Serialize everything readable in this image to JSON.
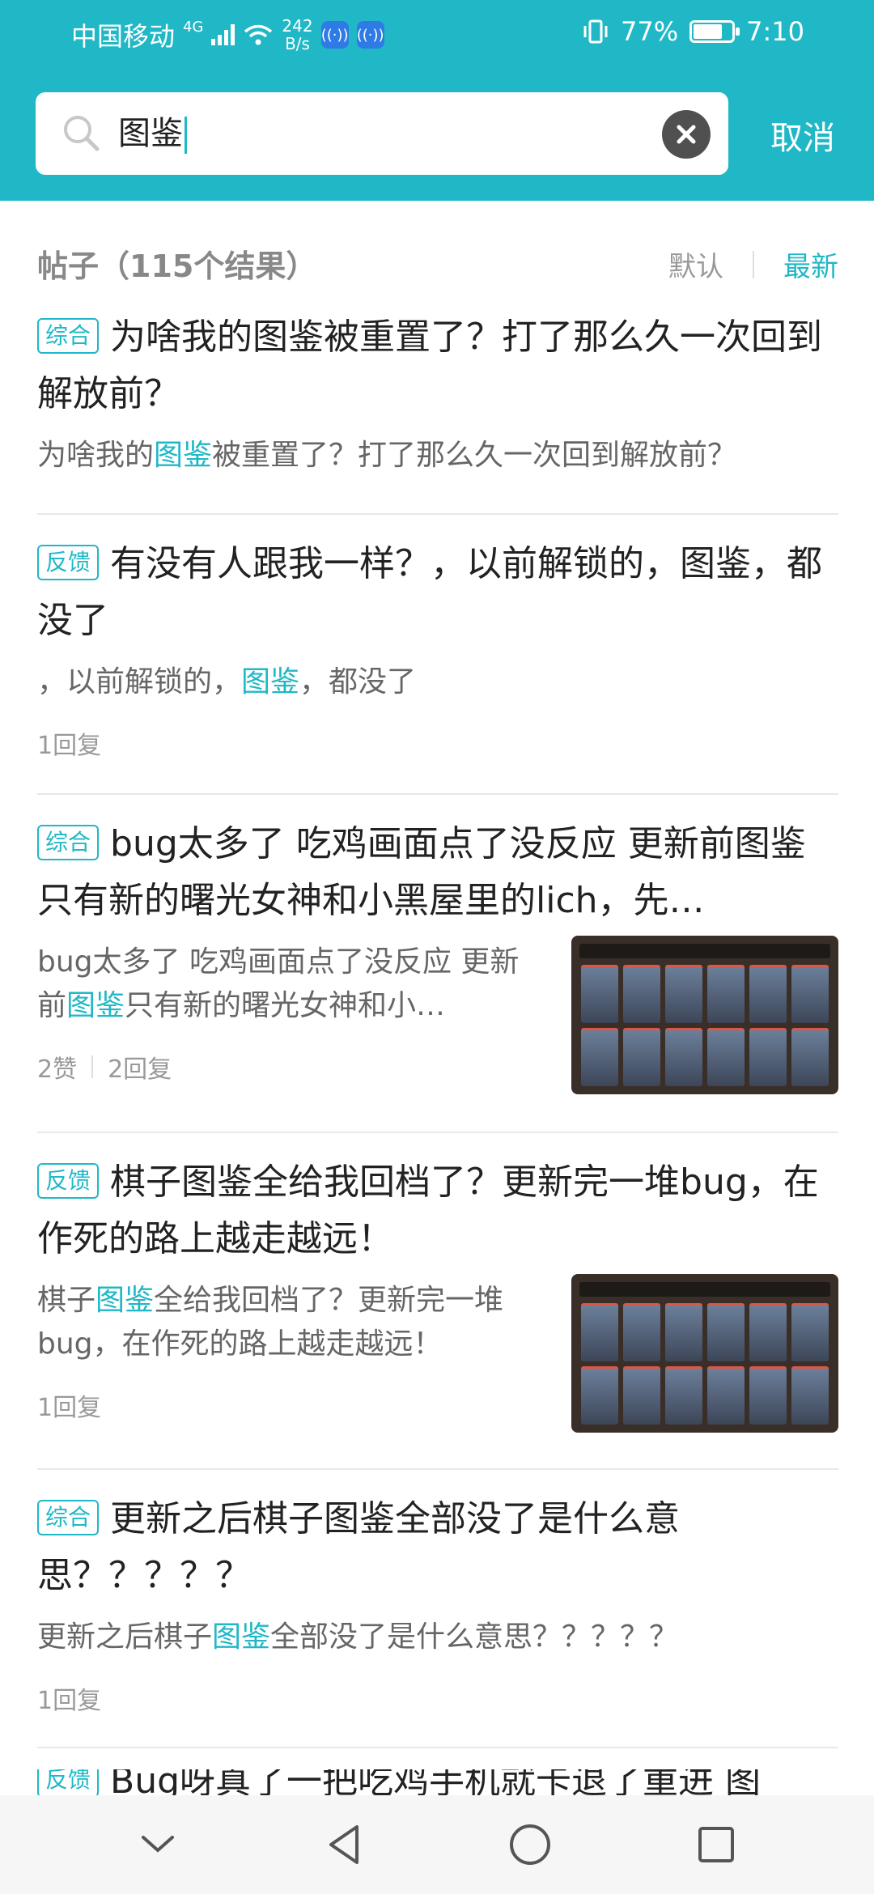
{
  "status_bar": {
    "carrier": "中国移动",
    "network": "4G",
    "net_speed_value": "242",
    "net_speed_unit": "B/s",
    "battery": "77%",
    "battery_level": 0.77,
    "time": "7:10"
  },
  "search": {
    "query": "图鉴",
    "cancel_label": "取消"
  },
  "results_header": {
    "title": "帖子（115个结果）",
    "sort_default": "默认",
    "sort_latest": "最新"
  },
  "posts": [
    {
      "tag": "综合",
      "title": "为啥我的图鉴被重置了？打了那么久一次回到解放前？",
      "excerpt_before": "为啥我的",
      "excerpt_highlight": "图鉴",
      "excerpt_after": "被重置了？打了那么久一次回到解放前？"
    },
    {
      "tag": "反馈",
      "title": "有没有人跟我一样？，以前解锁的，图鉴，都没了",
      "excerpt_before": "，以前解锁的，",
      "excerpt_highlight": "图鉴",
      "excerpt_after": "，都没了",
      "replies": "1回复"
    },
    {
      "tag": "综合",
      "title": "bug太多了 吃鸡画面点了没反应 更新前图鉴只有新的曙光女神和小黑屋里的lich，先…",
      "excerpt_before": "bug太多了 吃鸡画面点了没反应 更新前",
      "excerpt_highlight": "图鉴",
      "excerpt_after": "只有新的曙光女神和小…",
      "likes": "2赞",
      "replies": "2回复"
    },
    {
      "tag": "反馈",
      "title": "棋子图鉴全给我回档了？更新完一堆bug，在作死的路上越走越远！",
      "excerpt_before": "棋子",
      "excerpt_highlight": "图鉴",
      "excerpt_after": "全给我回档了？更新完一堆bug，在作死的路上越走越远！",
      "replies": "1回复"
    },
    {
      "tag": "综合",
      "title": "更新之后棋子图鉴全部没了是什么意思？？？？？",
      "excerpt_before": "更新之后棋子",
      "excerpt_highlight": "图鉴",
      "excerpt_after": "全部没了是什么意思？？？？？",
      "replies": "1回复"
    },
    {
      "tag": "反馈",
      "title": "Bug呀真了一把吃鸡手机就卡退了重进 图"
    }
  ],
  "colors": {
    "accent": "#20b8c6",
    "topbar": "#20b8c6"
  }
}
